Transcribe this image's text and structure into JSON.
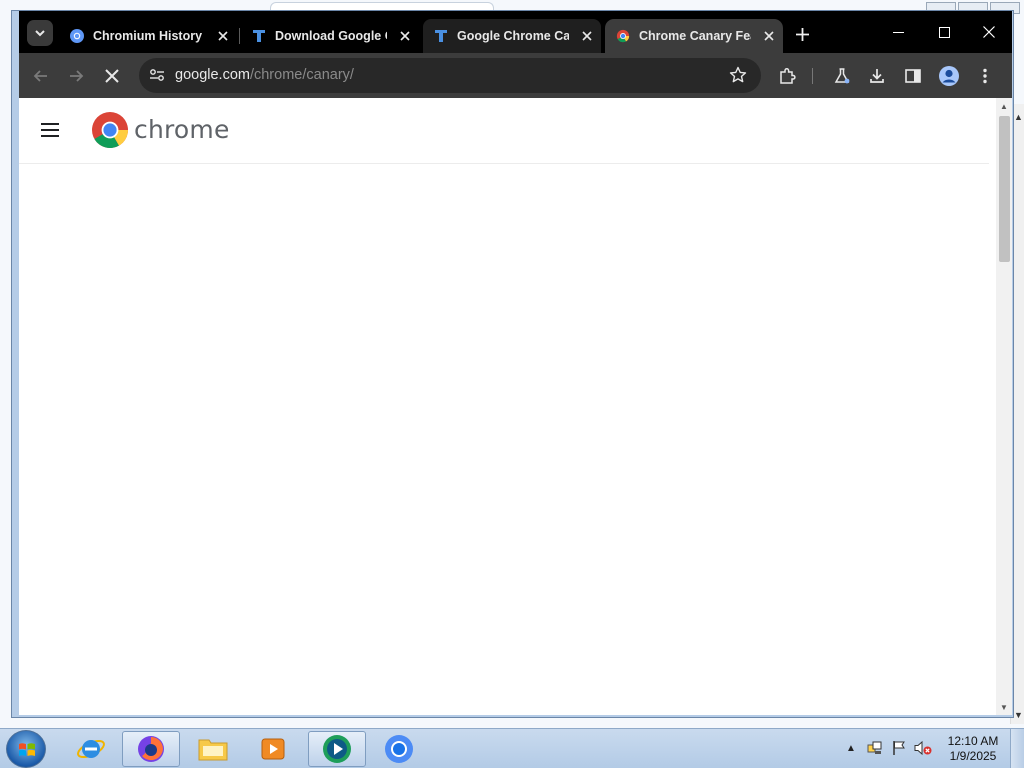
{
  "browser": {
    "tabs": [
      {
        "title": "Chromium History V",
        "favicon": "chromium-icon",
        "state": "inactive"
      },
      {
        "title": "Download Google Ch",
        "favicon": "t-letter-icon",
        "state": "inactive"
      },
      {
        "title": "Google Chrome Can",
        "favicon": "t-letter-icon",
        "state": "inactive-highlighted"
      },
      {
        "title": "Chrome Canary Feat",
        "favicon": "chrome-logo-icon",
        "state": "active"
      }
    ],
    "address": {
      "host": "google.com",
      "path": "/chrome/canary/"
    },
    "loading": true
  },
  "page": {
    "brand_text": "chrome"
  },
  "taskbar": {
    "apps": [
      "internet-explorer-icon",
      "firefox-icon",
      "file-explorer-icon",
      "media-player-icon",
      "media-center-icon",
      "chrome-icon"
    ],
    "clock": {
      "time": "12:10 AM",
      "date": "1/9/2025"
    }
  },
  "colors": {
    "tabstrip": "#000000",
    "toolbar": "#3c3c3c",
    "omnibox": "#282828",
    "window_frame": "#b5cce7"
  }
}
